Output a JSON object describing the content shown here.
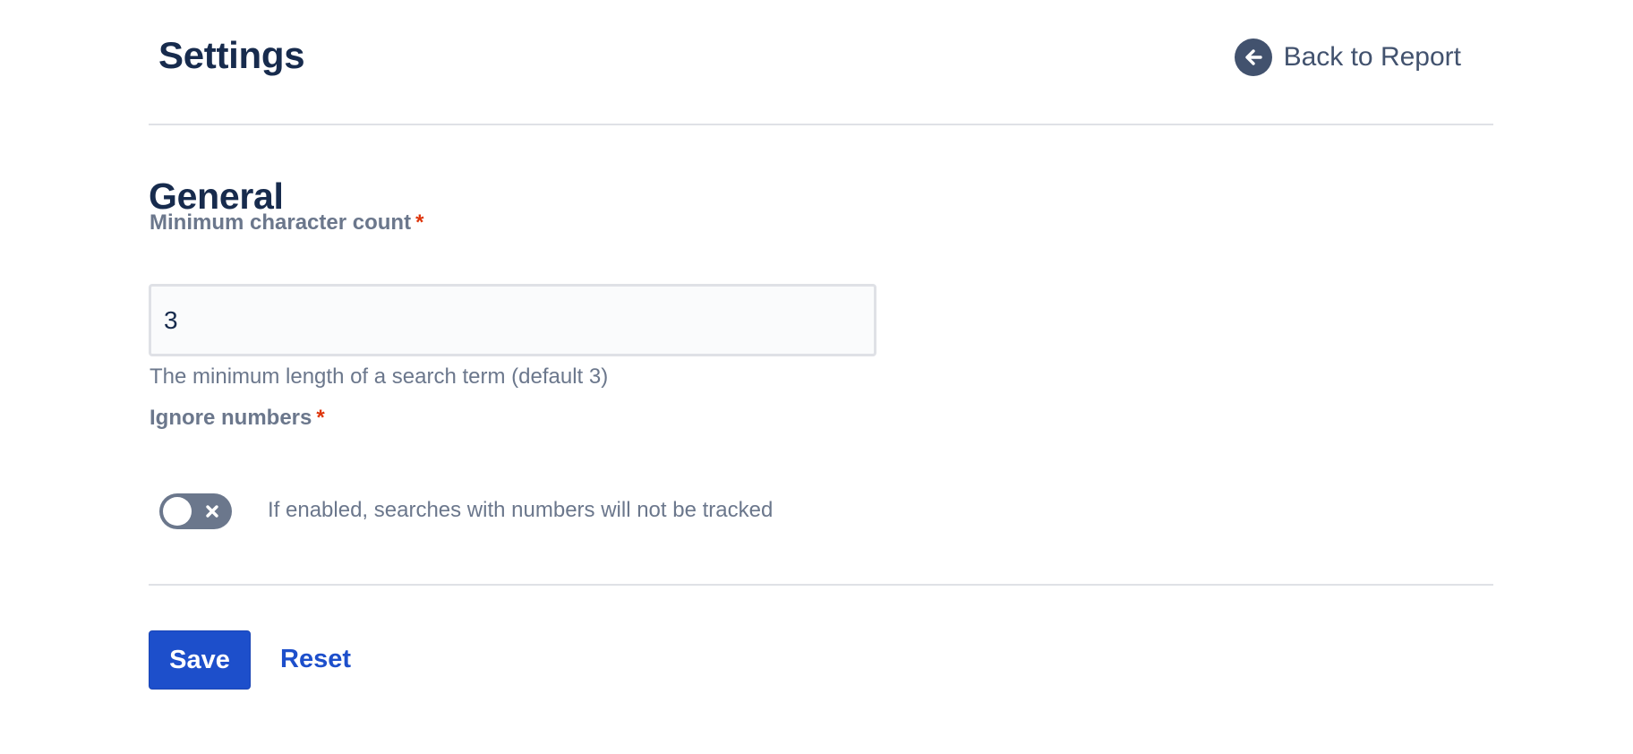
{
  "header": {
    "title": "Settings",
    "back_label": "Back to Report",
    "back_icon": "arrow-left-circle-icon"
  },
  "general": {
    "title": "General",
    "min_char": {
      "label": "Minimum character count",
      "required_marker": "*",
      "value": "3",
      "helper": "The minimum length of a search term (default 3)"
    },
    "ignore_numbers": {
      "label": "Ignore numbers",
      "required_marker": "*",
      "enabled": false,
      "description": "If enabled, searches with numbers will not be tracked"
    }
  },
  "actions": {
    "save_label": "Save",
    "reset_label": "Reset"
  },
  "colors": {
    "primary": "#1d4fcb",
    "required": "#de350b",
    "text_subtle": "#6b778c",
    "toggle_off": "#6b778c"
  }
}
